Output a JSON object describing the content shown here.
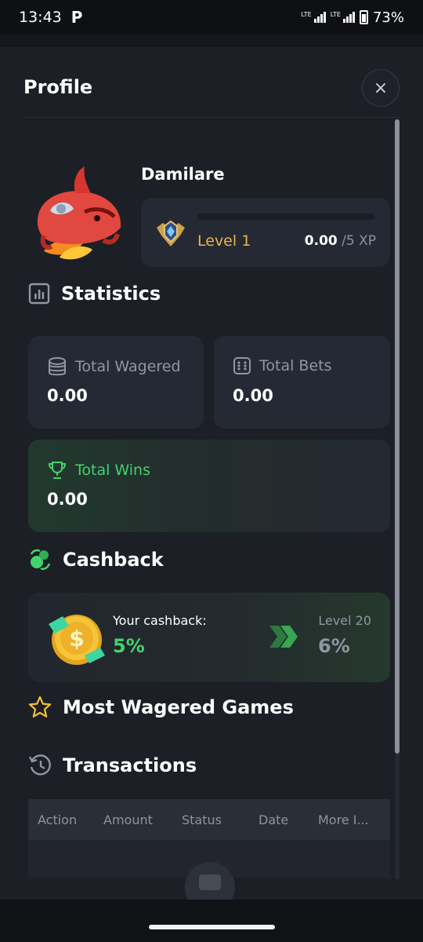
{
  "status_bar": {
    "time": "13:43",
    "app_icon": "P",
    "battery": "73%"
  },
  "profile": {
    "title": "Profile",
    "close_icon": "×",
    "username": "Damilare",
    "level": "Level 1",
    "xp_current": "0.00",
    "xp_max": "/5 XP",
    "xp_progress": 0
  },
  "statistics": {
    "title": "Statistics",
    "total_wagered": {
      "label": "Total Wagered",
      "value": "0.00"
    },
    "total_bets": {
      "label": "Total Bets",
      "value": "0.00"
    },
    "total_wins": {
      "label": "Total Wins",
      "value": "0.00"
    }
  },
  "cashback": {
    "title": "Cashback",
    "your_label": "Your cashback:",
    "your_value": "5%",
    "next_level_label": "Level 20",
    "next_level_value": "6%"
  },
  "most_wagered": {
    "title": "Most Wagered Games"
  },
  "transactions": {
    "title": "Transactions",
    "columns": [
      "Action",
      "Amount",
      "Status",
      "Date",
      "More I..."
    ]
  },
  "colors": {
    "accent_green": "#43d36c",
    "level_gold": "#e9b54a",
    "background": "#1c1f26"
  }
}
